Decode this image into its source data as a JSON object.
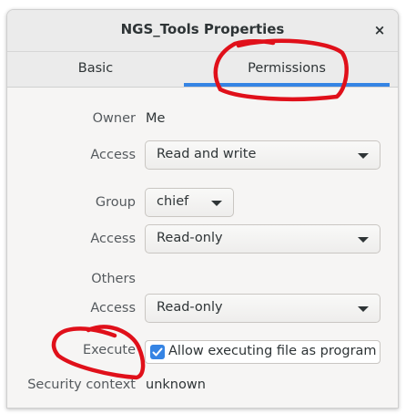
{
  "window": {
    "title": "NGS_Tools Properties",
    "close_glyph": "×"
  },
  "tabs": [
    {
      "label": "Basic",
      "active": false
    },
    {
      "label": "Permissions",
      "active": true
    }
  ],
  "permissions": {
    "owner_label": "Owner",
    "owner_value": "Me",
    "owner_access_label": "Access",
    "owner_access_value": "Read and write",
    "group_label": "Group",
    "group_value": "chief",
    "group_access_label": "Access",
    "group_access_value": "Read-only",
    "others_label": "Others",
    "others_access_label": "Access",
    "others_access_value": "Read-only",
    "execute_label": "Execute",
    "execute_checkbox_label": "Allow executing file as program",
    "execute_checked": true,
    "security_label": "Security context",
    "security_value": "unknown"
  },
  "colors": {
    "accent": "#3584e4",
    "annotation": "#e0101a"
  }
}
